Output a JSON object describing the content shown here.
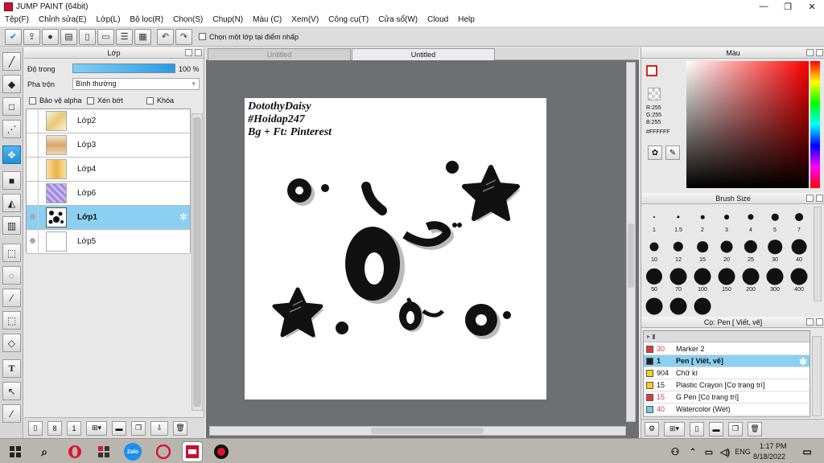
{
  "window": {
    "title": "JUMP PAINT (64bit)",
    "minimize": "—",
    "maximize": "❐",
    "close": "✕"
  },
  "menu": [
    "Tệp(F)",
    "Chỉnh sửa(E)",
    "Lớp(L)",
    "Bộ lọc(R)",
    "Chọn(S)",
    "Chụp(N)",
    "Màu (C)",
    "Xem(V)",
    "Công cụ(T)",
    "Cửa sổ(W)",
    "Cloud",
    "Help"
  ],
  "toolbar": {
    "snap_label": "Chọn một lớp tại điểm nhấp"
  },
  "layer_panel": {
    "title": "Lớp",
    "opacity_label": "Độ trong",
    "opacity_value": "100 %",
    "blend_label": "Pha trộn",
    "blend_value": "Bình thường",
    "protect_alpha": "Bảo vệ alpha",
    "clipping": "Xén bớt",
    "lock": "Khóa",
    "layers": [
      {
        "name": "Lớp2",
        "selected": false
      },
      {
        "name": "Lớp3",
        "selected": false
      },
      {
        "name": "Lớp4",
        "selected": false
      },
      {
        "name": "Lớp6",
        "selected": false
      },
      {
        "name": "Lớp1",
        "selected": true
      },
      {
        "name": "Lớp5",
        "selected": false
      }
    ]
  },
  "canvas_tabs": [
    "Untitled",
    "Untitled"
  ],
  "canvas_text": [
    "DotothyDaisy",
    "#Hoidap247",
    "Bg + Ft: Pinterest"
  ],
  "color_panel": {
    "title": "Màu",
    "r": "R:255",
    "g": "G:255",
    "b": "B:255",
    "hex": "#FFFFFF"
  },
  "brush_panel": {
    "title": "Brush Size",
    "sizes": [
      "1",
      "1.5",
      "2",
      "3",
      "4",
      "5",
      "7",
      "10",
      "12",
      "15",
      "20",
      "25",
      "30",
      "40",
      "50",
      "70",
      "100",
      "150",
      "200",
      "300",
      "400"
    ]
  },
  "tool_panel": {
    "title": "Cọ: Pen [ Viết, vẽ]",
    "items": [
      {
        "size": "30",
        "name": "Marker 2",
        "color": "#e03c3c",
        "selected": false
      },
      {
        "size": "1",
        "name": "Pen [ Viết, vẽ]",
        "color": "#222222",
        "selected": true
      },
      {
        "size": "904",
        "name": "Chữ kí",
        "color": "#f2d21b",
        "selected": false
      },
      {
        "size": "15",
        "name": "Plastic Crayon [Cọ trang trí]",
        "color": "#f2d21b",
        "selected": false
      },
      {
        "size": "15",
        "name": "G Pen [Cọ trang trí]",
        "color": "#e03c3c",
        "selected": false
      },
      {
        "size": "40",
        "name": "Watercolor (Wet)",
        "color": "#6fc8ef",
        "selected": false
      }
    ]
  },
  "taskbar": {
    "time": "1:17 PM",
    "date": "8/18/2022",
    "lang": "ENG",
    "zalo": "Zalo"
  }
}
